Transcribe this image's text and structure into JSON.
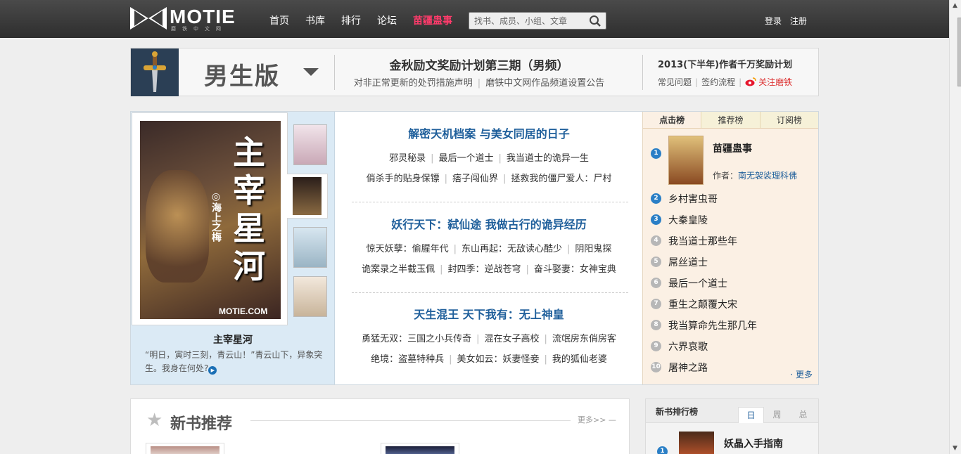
{
  "header": {
    "logo_text": "MOTIE",
    "logo_sub": "磨铁中文网",
    "nav": [
      "首页",
      "书库",
      "排行",
      "论坛",
      "苗疆蛊事"
    ],
    "search_placeholder": "找书、成员、小组、文章",
    "login": "登录",
    "register": "注册",
    "colors": {
      "bar": "#333333",
      "hot": "#ff3b6b"
    }
  },
  "banner": {
    "edition": "男生版",
    "center_title": "金秋励文奖励计划第三期（男频）",
    "center_link1": "对非正常更新的处罚措施声明",
    "center_sep": "|",
    "center_link2": "磨铁中文网作品频道设置公告",
    "right_title": "2013(下半年)作者千万奖励计划",
    "right_links": [
      "常见问题",
      "签约流程"
    ],
    "right_sep": "|",
    "weibo": "关注磨铁"
  },
  "feature": {
    "cover_title_chars": "主宰星河",
    "cover_author": "◎海上之梅",
    "cover_brand": "MOTIE.COM",
    "title": "主宰星河",
    "desc": "“明日，寅时三刻，青云山！”青云山下，异象突生。我身在何处?",
    "groups": [
      {
        "heading": "解密天机档案  与美女同居的日子",
        "rows": [
          [
            "邪灵秘录",
            "最后一个道士",
            "我当道士的诡异一生"
          ],
          [
            "俏杀手的贴身保镖",
            "痞子闯仙界",
            "拯救我的僵尸爱人：尸村"
          ]
        ]
      },
      {
        "heading": "妖行天下：弑仙途  我做古行的诡异经历",
        "rows": [
          [
            "惊天妖孽：偷腥年代",
            "东山再起：无敌读心酷少",
            "阴阳鬼探"
          ],
          [
            "诡案录之半截玉佩",
            "封四季：逆战苍穹",
            "奋斗娶妻：女神宝典"
          ]
        ]
      },
      {
        "heading": "天生混王  天下我有：无上神皇",
        "rows": [
          [
            "勇猛无双：三国之小兵传奇",
            "混在女子高校",
            "流氓房东俏房客"
          ],
          [
            "绝境：盗墓特种兵",
            "美女如云：妖妻怪妾",
            "我的狐仙老婆"
          ]
        ]
      }
    ],
    "row_sep": "|"
  },
  "ranking": {
    "tabs": [
      "点击榜",
      "推荐榜",
      "订阅榜"
    ],
    "first": {
      "rank": "1",
      "title": "苗疆蛊事",
      "author_label": "作者：",
      "author": "南无袈裟理科佛"
    },
    "items": [
      {
        "rank": "2",
        "title": "乡村害虫哥"
      },
      {
        "rank": "3",
        "title": "大秦皇陵"
      },
      {
        "rank": "4",
        "title": "我当道士那些年"
      },
      {
        "rank": "5",
        "title": "屌丝道士"
      },
      {
        "rank": "6",
        "title": "最后一个道士"
      },
      {
        "rank": "7",
        "title": "重生之颠覆大宋"
      },
      {
        "rank": "8",
        "title": "我当算命先生那几年"
      },
      {
        "rank": "9",
        "title": "六界哀歌"
      },
      {
        "rank": "10",
        "title": "屠神之路"
      }
    ],
    "more": "· 更多"
  },
  "newbooks": {
    "heading": "新书推荐",
    "more": "更多>> —"
  },
  "newrank": {
    "heading": "新书排行榜",
    "tabs": [
      "日",
      "周",
      "总"
    ],
    "first": {
      "rank": "1",
      "title": "妖晶入手指南"
    }
  }
}
